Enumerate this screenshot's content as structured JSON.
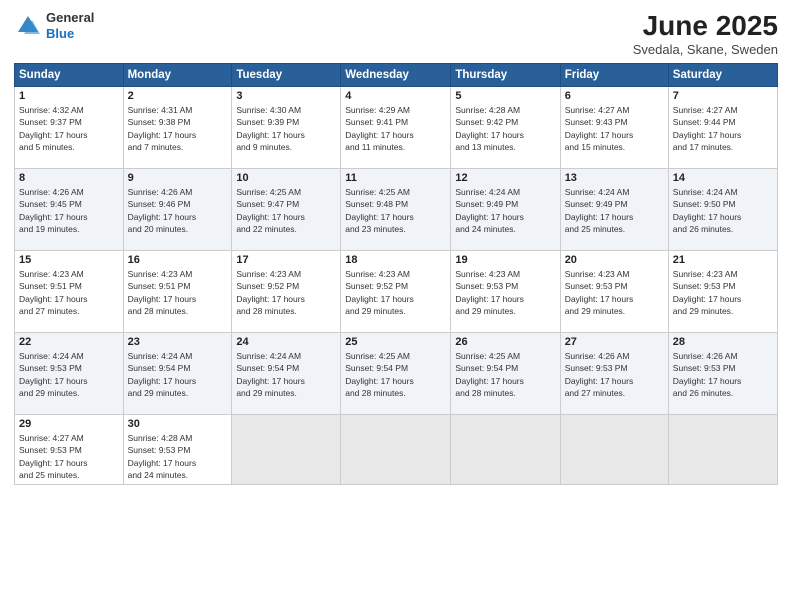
{
  "header": {
    "logo": {
      "general": "General",
      "blue": "Blue"
    },
    "title": "June 2025",
    "location": "Svedala, Skane, Sweden"
  },
  "days_of_week": [
    "Sunday",
    "Monday",
    "Tuesday",
    "Wednesday",
    "Thursday",
    "Friday",
    "Saturday"
  ],
  "weeks": [
    [
      {
        "day": "1",
        "info": "Sunrise: 4:32 AM\nSunset: 9:37 PM\nDaylight: 17 hours\nand 5 minutes."
      },
      {
        "day": "2",
        "info": "Sunrise: 4:31 AM\nSunset: 9:38 PM\nDaylight: 17 hours\nand 7 minutes."
      },
      {
        "day": "3",
        "info": "Sunrise: 4:30 AM\nSunset: 9:39 PM\nDaylight: 17 hours\nand 9 minutes."
      },
      {
        "day": "4",
        "info": "Sunrise: 4:29 AM\nSunset: 9:41 PM\nDaylight: 17 hours\nand 11 minutes."
      },
      {
        "day": "5",
        "info": "Sunrise: 4:28 AM\nSunset: 9:42 PM\nDaylight: 17 hours\nand 13 minutes."
      },
      {
        "day": "6",
        "info": "Sunrise: 4:27 AM\nSunset: 9:43 PM\nDaylight: 17 hours\nand 15 minutes."
      },
      {
        "day": "7",
        "info": "Sunrise: 4:27 AM\nSunset: 9:44 PM\nDaylight: 17 hours\nand 17 minutes."
      }
    ],
    [
      {
        "day": "8",
        "info": "Sunrise: 4:26 AM\nSunset: 9:45 PM\nDaylight: 17 hours\nand 19 minutes."
      },
      {
        "day": "9",
        "info": "Sunrise: 4:26 AM\nSunset: 9:46 PM\nDaylight: 17 hours\nand 20 minutes."
      },
      {
        "day": "10",
        "info": "Sunrise: 4:25 AM\nSunset: 9:47 PM\nDaylight: 17 hours\nand 22 minutes."
      },
      {
        "day": "11",
        "info": "Sunrise: 4:25 AM\nSunset: 9:48 PM\nDaylight: 17 hours\nand 23 minutes."
      },
      {
        "day": "12",
        "info": "Sunrise: 4:24 AM\nSunset: 9:49 PM\nDaylight: 17 hours\nand 24 minutes."
      },
      {
        "day": "13",
        "info": "Sunrise: 4:24 AM\nSunset: 9:49 PM\nDaylight: 17 hours\nand 25 minutes."
      },
      {
        "day": "14",
        "info": "Sunrise: 4:24 AM\nSunset: 9:50 PM\nDaylight: 17 hours\nand 26 minutes."
      }
    ],
    [
      {
        "day": "15",
        "info": "Sunrise: 4:23 AM\nSunset: 9:51 PM\nDaylight: 17 hours\nand 27 minutes."
      },
      {
        "day": "16",
        "info": "Sunrise: 4:23 AM\nSunset: 9:51 PM\nDaylight: 17 hours\nand 28 minutes."
      },
      {
        "day": "17",
        "info": "Sunrise: 4:23 AM\nSunset: 9:52 PM\nDaylight: 17 hours\nand 28 minutes."
      },
      {
        "day": "18",
        "info": "Sunrise: 4:23 AM\nSunset: 9:52 PM\nDaylight: 17 hours\nand 29 minutes."
      },
      {
        "day": "19",
        "info": "Sunrise: 4:23 AM\nSunset: 9:53 PM\nDaylight: 17 hours\nand 29 minutes."
      },
      {
        "day": "20",
        "info": "Sunrise: 4:23 AM\nSunset: 9:53 PM\nDaylight: 17 hours\nand 29 minutes."
      },
      {
        "day": "21",
        "info": "Sunrise: 4:23 AM\nSunset: 9:53 PM\nDaylight: 17 hours\nand 29 minutes."
      }
    ],
    [
      {
        "day": "22",
        "info": "Sunrise: 4:24 AM\nSunset: 9:53 PM\nDaylight: 17 hours\nand 29 minutes."
      },
      {
        "day": "23",
        "info": "Sunrise: 4:24 AM\nSunset: 9:54 PM\nDaylight: 17 hours\nand 29 minutes."
      },
      {
        "day": "24",
        "info": "Sunrise: 4:24 AM\nSunset: 9:54 PM\nDaylight: 17 hours\nand 29 minutes."
      },
      {
        "day": "25",
        "info": "Sunrise: 4:25 AM\nSunset: 9:54 PM\nDaylight: 17 hours\nand 28 minutes."
      },
      {
        "day": "26",
        "info": "Sunrise: 4:25 AM\nSunset: 9:54 PM\nDaylight: 17 hours\nand 28 minutes."
      },
      {
        "day": "27",
        "info": "Sunrise: 4:26 AM\nSunset: 9:53 PM\nDaylight: 17 hours\nand 27 minutes."
      },
      {
        "day": "28",
        "info": "Sunrise: 4:26 AM\nSunset: 9:53 PM\nDaylight: 17 hours\nand 26 minutes."
      }
    ],
    [
      {
        "day": "29",
        "info": "Sunrise: 4:27 AM\nSunset: 9:53 PM\nDaylight: 17 hours\nand 25 minutes."
      },
      {
        "day": "30",
        "info": "Sunrise: 4:28 AM\nSunset: 9:53 PM\nDaylight: 17 hours\nand 24 minutes."
      },
      {
        "day": "",
        "info": ""
      },
      {
        "day": "",
        "info": ""
      },
      {
        "day": "",
        "info": ""
      },
      {
        "day": "",
        "info": ""
      },
      {
        "day": "",
        "info": ""
      }
    ]
  ]
}
